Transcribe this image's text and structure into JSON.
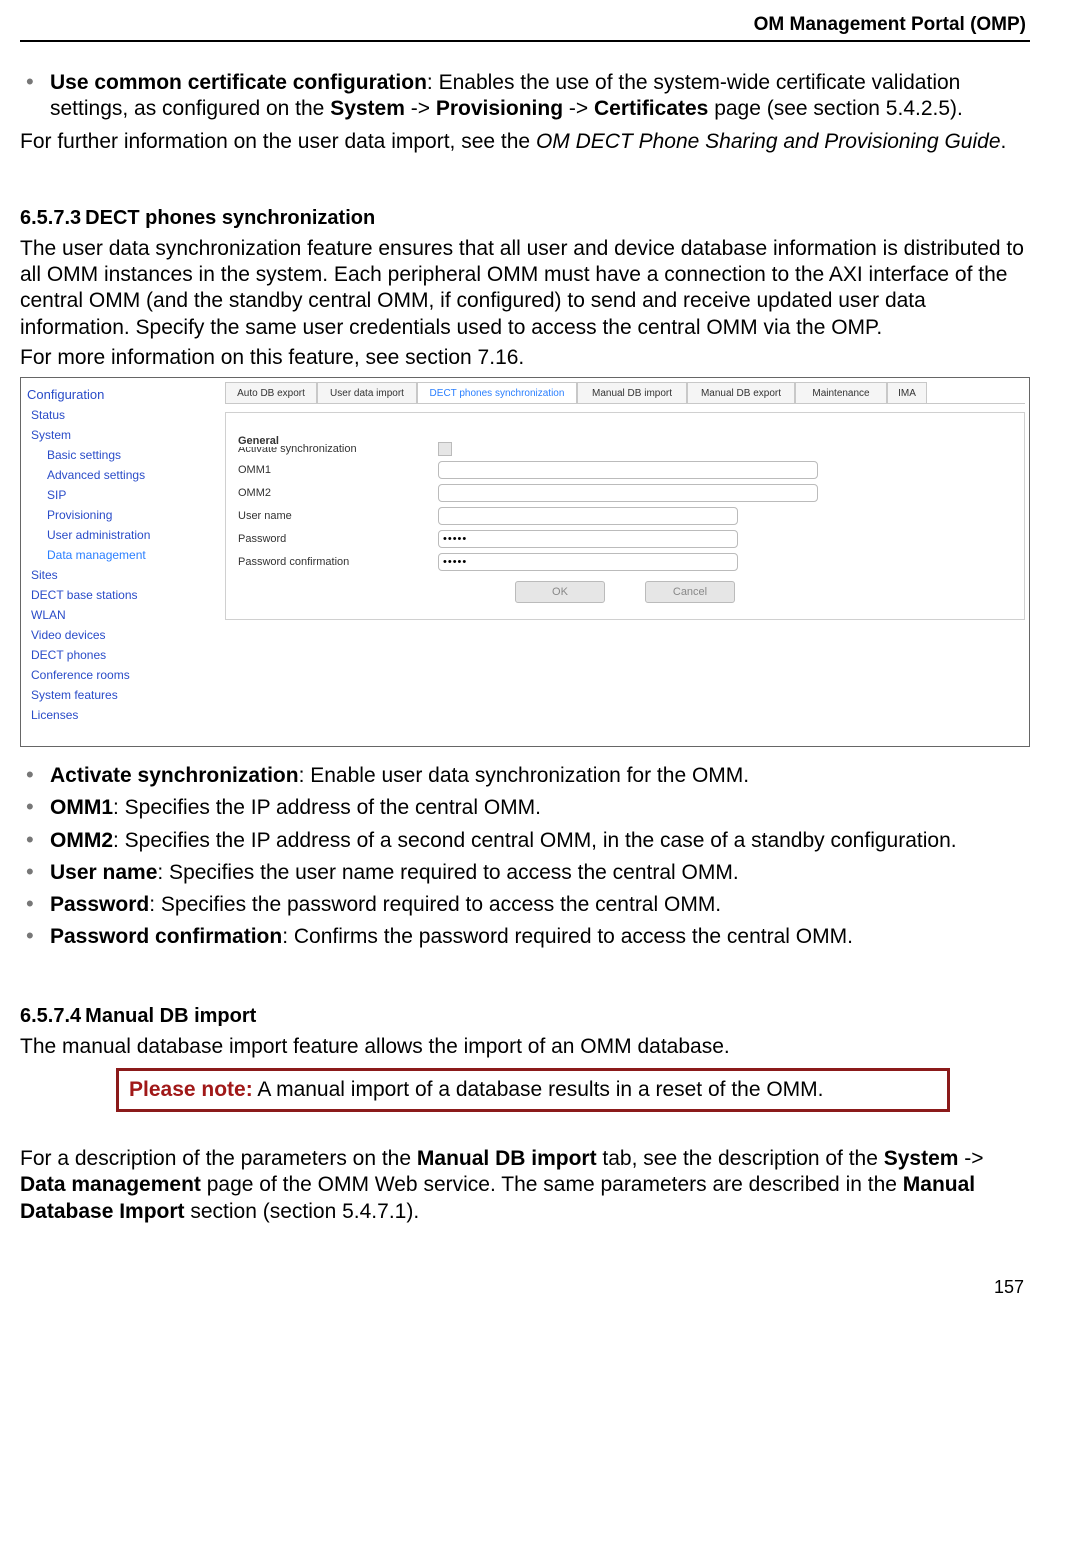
{
  "header": {
    "title": "OM Management Portal (OMP)"
  },
  "top_bullet": {
    "term": "Use common certificate configuration",
    "text_a": ": Enables the use of the system-wide certificate validation settings, as configured on the ",
    "path1": "System",
    "arrow1": " -> ",
    "path2": "Provisioning",
    "arrow2": " -> ",
    "path3": "Certificates",
    "text_b": " page (see section 5.4.2.5)."
  },
  "top_para_a": "For further information on the user data import, see the ",
  "top_para_i": "OM DECT Phone Sharing and Provisioning Guide",
  "top_para_b": ".",
  "section1": {
    "num": "6.5.7.3",
    "title": "DECT phones synchronization",
    "para1": "The user data synchronization feature ensures that all user and device database information is distributed to all OMM instances in the system. Each peripheral OMM must have a connection to the AXI interface of the central OMM (and the standby central OMM, if configured) to send and receive updated user data information. Specify the same user credentials used to access the central OMM via the OMP.",
    "para2": "For more information on this feature, see section 7.16."
  },
  "screenshot": {
    "nav_title": "Configuration",
    "nav": [
      {
        "label": "Status",
        "sub": false
      },
      {
        "label": "System",
        "sub": false
      },
      {
        "label": "Basic settings",
        "sub": true
      },
      {
        "label": "Advanced settings",
        "sub": true
      },
      {
        "label": "SIP",
        "sub": true
      },
      {
        "label": "Provisioning",
        "sub": true
      },
      {
        "label": "User administration",
        "sub": true
      },
      {
        "label": "Data management",
        "sub": true,
        "active": true
      },
      {
        "label": "Sites",
        "sub": false
      },
      {
        "label": "DECT base stations",
        "sub": false
      },
      {
        "label": "WLAN",
        "sub": false
      },
      {
        "label": "Video devices",
        "sub": false
      },
      {
        "label": "DECT phones",
        "sub": false
      },
      {
        "label": "Conference rooms",
        "sub": false
      },
      {
        "label": "System features",
        "sub": false
      },
      {
        "label": "Licenses",
        "sub": false
      }
    ],
    "tabs": [
      "Auto DB export",
      "User data import",
      "DECT phones synchronization",
      "Manual DB import",
      "Manual DB export",
      "Maintenance",
      "IMA"
    ],
    "active_tab_index": 2,
    "legend": "General",
    "fields": {
      "activate": "Activate synchronization",
      "omm1": "OMM1",
      "omm2": "OMM2",
      "user": "User name",
      "password": "Password",
      "password_conf": "Password confirmation",
      "pw_value": "•••••"
    },
    "buttons": {
      "ok": "OK",
      "cancel": "Cancel"
    }
  },
  "field_bullets": [
    {
      "term": "Activate synchronization",
      "text": ": Enable user data synchronization for the OMM."
    },
    {
      "term": "OMM1",
      "text": ": Specifies the IP address of the central OMM."
    },
    {
      "term": "OMM2",
      "text": ": Specifies the IP address of a second central OMM, in the case of a standby configuration."
    },
    {
      "term": "User name",
      "text": ": Specifies the user name required to access the central OMM."
    },
    {
      "term": "Password",
      "text": ": Specifies the password required to access the central OMM."
    },
    {
      "term": "Password confirmation",
      "text": ": Confirms the password required to access the central OMM."
    }
  ],
  "section2": {
    "num": "6.5.7.4",
    "title": "Manual DB import",
    "para1": "The manual database import feature allows the import of an OMM database."
  },
  "note": {
    "label": "Please note:",
    "text": "  A manual import of a database results in a reset of the OMM."
  },
  "bottom": {
    "a": "For a description of the parameters on the ",
    "b": "Manual DB import",
    "c": " tab, see the description of the ",
    "d": "System",
    "e": " -> ",
    "f": "Data management",
    "g": " page of the OMM Web service. The same parameters are described in the ",
    "h": "Manual Database Import",
    "i": " section (section 5.4.7.1)."
  },
  "page_number": "157"
}
